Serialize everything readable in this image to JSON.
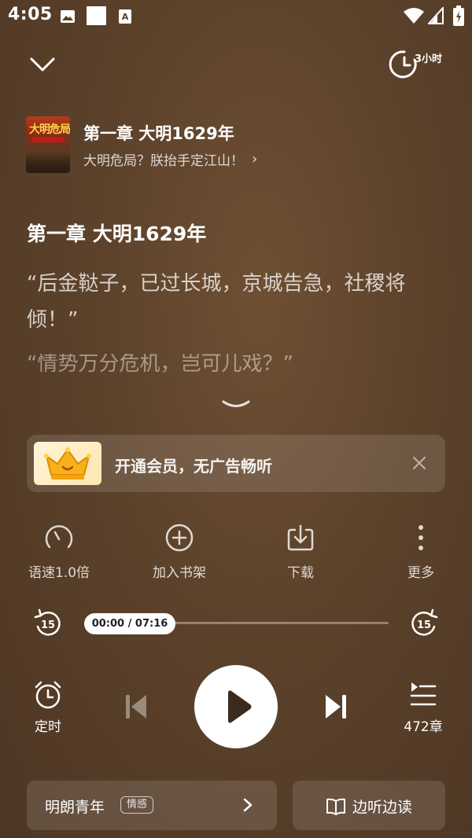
{
  "status_bar": {
    "time": "4:05"
  },
  "top_bar": {
    "sleep_timer_label": "3小时"
  },
  "book": {
    "cover_title": "大明危局",
    "chapter_title": "第一章 大明1629年",
    "book_name": "大明危局？朕抬手定江山！",
    "book_name_chevron": "›"
  },
  "content": {
    "heading": "第一章 大明1629年",
    "paragraphs": [
      "“后金鞑子，已过长城，京城告急，社稷将倾！”",
      "“情势万分危机，岂可儿戏？”"
    ]
  },
  "vip_banner": {
    "text": "开通会员，无广告畅听"
  },
  "actions": {
    "speed": "语速1.0倍",
    "add_shelf": "加入书架",
    "download": "下载",
    "more": "更多"
  },
  "progress": {
    "time_text": "00:00 / 07:16",
    "fraction": 0.0,
    "skip_seconds": "15"
  },
  "controls": {
    "timer": "定时",
    "chapters": "472章"
  },
  "bottom": {
    "voice_name": "明朗青年",
    "voice_tag": "情感",
    "read_label": "边听边读"
  }
}
